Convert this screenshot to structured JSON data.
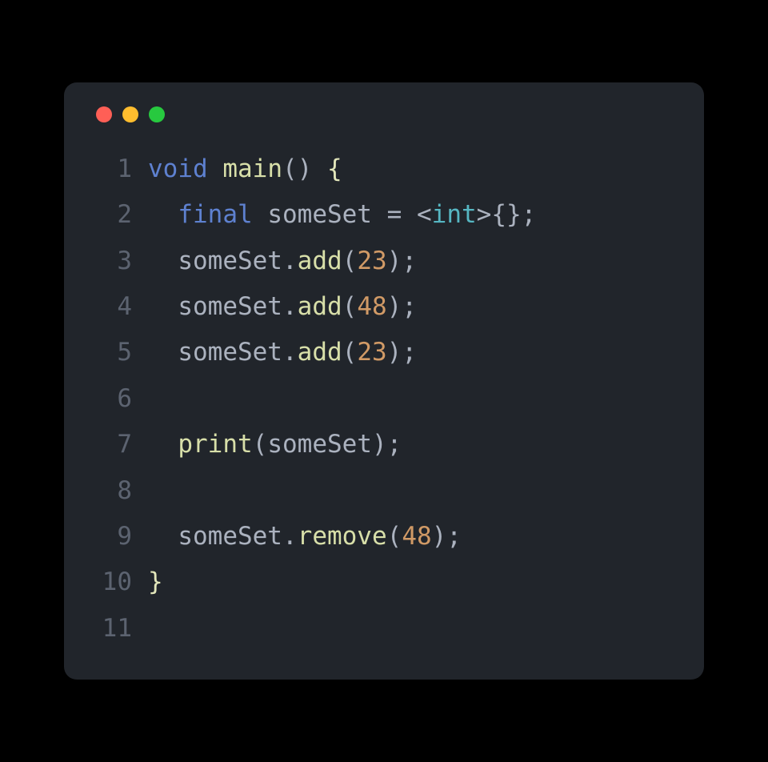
{
  "window": {
    "traffic_lights": {
      "red": "#ff5f56",
      "yellow": "#ffbd2e",
      "green": "#27c93f"
    }
  },
  "code": {
    "language": "dart",
    "lines": [
      {
        "number": "1",
        "tokens": [
          {
            "text": "void",
            "type": "keyword"
          },
          {
            "text": " ",
            "type": "space"
          },
          {
            "text": "main",
            "type": "function"
          },
          {
            "text": "()",
            "type": "paren"
          },
          {
            "text": " ",
            "type": "space"
          },
          {
            "text": "{",
            "type": "brace"
          }
        ]
      },
      {
        "number": "2",
        "tokens": [
          {
            "text": "  ",
            "type": "space"
          },
          {
            "text": "final",
            "type": "keyword"
          },
          {
            "text": " ",
            "type": "space"
          },
          {
            "text": "someSet",
            "type": "identifier"
          },
          {
            "text": " ",
            "type": "space"
          },
          {
            "text": "=",
            "type": "operator"
          },
          {
            "text": " ",
            "type": "space"
          },
          {
            "text": "<",
            "type": "angle"
          },
          {
            "text": "int",
            "type": "type"
          },
          {
            "text": ">",
            "type": "angle"
          },
          {
            "text": "{};",
            "type": "punct"
          }
        ]
      },
      {
        "number": "3",
        "tokens": [
          {
            "text": "  ",
            "type": "space"
          },
          {
            "text": "someSet",
            "type": "identifier"
          },
          {
            "text": ".",
            "type": "punct"
          },
          {
            "text": "add",
            "type": "method"
          },
          {
            "text": "(",
            "type": "paren"
          },
          {
            "text": "23",
            "type": "number"
          },
          {
            "text": ");",
            "type": "punct"
          }
        ]
      },
      {
        "number": "4",
        "tokens": [
          {
            "text": "  ",
            "type": "space"
          },
          {
            "text": "someSet",
            "type": "identifier"
          },
          {
            "text": ".",
            "type": "punct"
          },
          {
            "text": "add",
            "type": "method"
          },
          {
            "text": "(",
            "type": "paren"
          },
          {
            "text": "48",
            "type": "number"
          },
          {
            "text": ");",
            "type": "punct"
          }
        ]
      },
      {
        "number": "5",
        "tokens": [
          {
            "text": "  ",
            "type": "space"
          },
          {
            "text": "someSet",
            "type": "identifier"
          },
          {
            "text": ".",
            "type": "punct"
          },
          {
            "text": "add",
            "type": "method"
          },
          {
            "text": "(",
            "type": "paren"
          },
          {
            "text": "23",
            "type": "number"
          },
          {
            "text": ");",
            "type": "punct"
          }
        ]
      },
      {
        "number": "6",
        "tokens": []
      },
      {
        "number": "7",
        "tokens": [
          {
            "text": "  ",
            "type": "space"
          },
          {
            "text": "print",
            "type": "function"
          },
          {
            "text": "(",
            "type": "paren"
          },
          {
            "text": "someSet",
            "type": "identifier"
          },
          {
            "text": ");",
            "type": "punct"
          }
        ]
      },
      {
        "number": "8",
        "tokens": []
      },
      {
        "number": "9",
        "tokens": [
          {
            "text": "  ",
            "type": "space"
          },
          {
            "text": "someSet",
            "type": "identifier"
          },
          {
            "text": ".",
            "type": "punct"
          },
          {
            "text": "remove",
            "type": "method"
          },
          {
            "text": "(",
            "type": "paren"
          },
          {
            "text": "48",
            "type": "number"
          },
          {
            "text": ");",
            "type": "punct"
          }
        ]
      },
      {
        "number": "10",
        "tokens": [
          {
            "text": "}",
            "type": "brace"
          }
        ]
      },
      {
        "number": "11",
        "tokens": []
      }
    ]
  }
}
